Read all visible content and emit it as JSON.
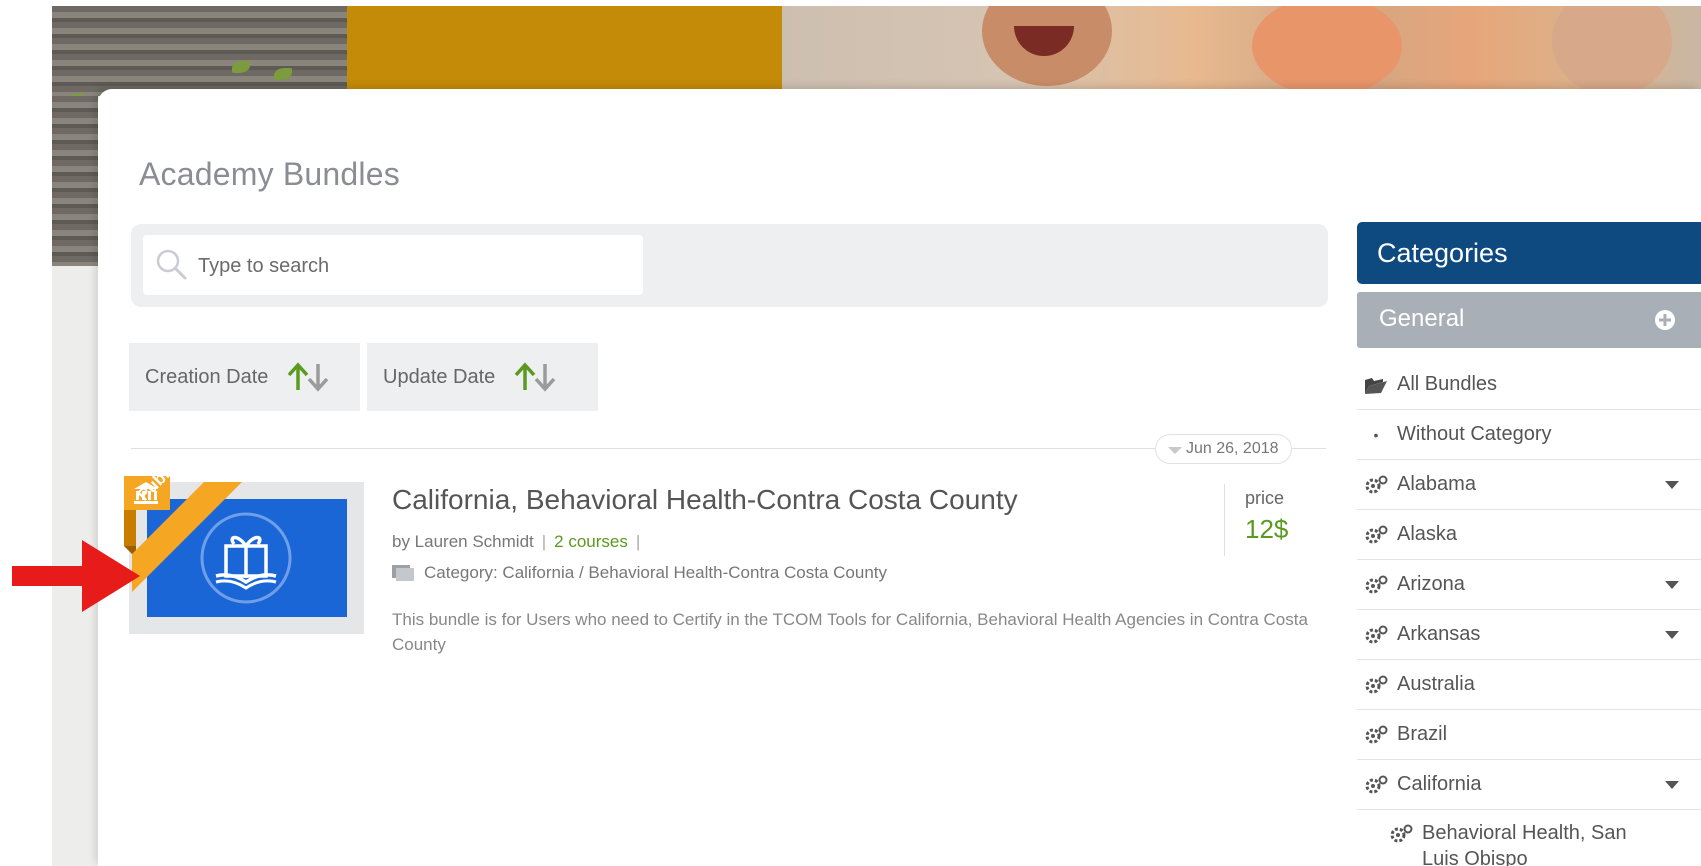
{
  "page": {
    "title": "Academy Bundles"
  },
  "search": {
    "placeholder": "Type to search"
  },
  "sort": {
    "creation_label": "Creation Date",
    "update_label": "Update Date"
  },
  "bundle": {
    "date": "Jun 26, 2018",
    "badge": "Public",
    "title": "California, Behavioral Health-Contra Costa County",
    "author": "by Lauren Schmidt",
    "courses": "2 courses",
    "category": "Category: California / Behavioral Health-Contra Costa County",
    "description": "This bundle is for Users who need to Certify in the TCOM Tools for California, Behavioral Health Agencies in Contra Costa County",
    "price_label": "price",
    "price_value": "12$"
  },
  "categories": {
    "header": "Categories",
    "general": "General",
    "items": [
      {
        "label": "All Bundles",
        "icon": "folder-icon",
        "expandable": false
      },
      {
        "label": "Without Category",
        "icon": "bullet",
        "expandable": false
      },
      {
        "label": "Alabama",
        "icon": "gears-icon",
        "expandable": true
      },
      {
        "label": "Alaska",
        "icon": "gears-icon",
        "expandable": false
      },
      {
        "label": "Arizona",
        "icon": "gears-icon",
        "expandable": true
      },
      {
        "label": "Arkansas",
        "icon": "gears-icon",
        "expandable": true
      },
      {
        "label": "Australia",
        "icon": "gears-icon",
        "expandable": false
      },
      {
        "label": "Brazil",
        "icon": "gears-icon",
        "expandable": false
      },
      {
        "label": "California",
        "icon": "gears-icon",
        "expandable": true
      }
    ],
    "sub_item": "Behavioral Health, San Luis Obispo"
  },
  "colors": {
    "category_header": "#0e4a80",
    "general_header": "#a8afb7",
    "sort_arrow_up": "#5a9a1f",
    "price": "#5a9a1f",
    "thumbnail": "#1b66d6",
    "ribbon": "#f5a623",
    "annotation_arrow": "#e81b1b"
  }
}
